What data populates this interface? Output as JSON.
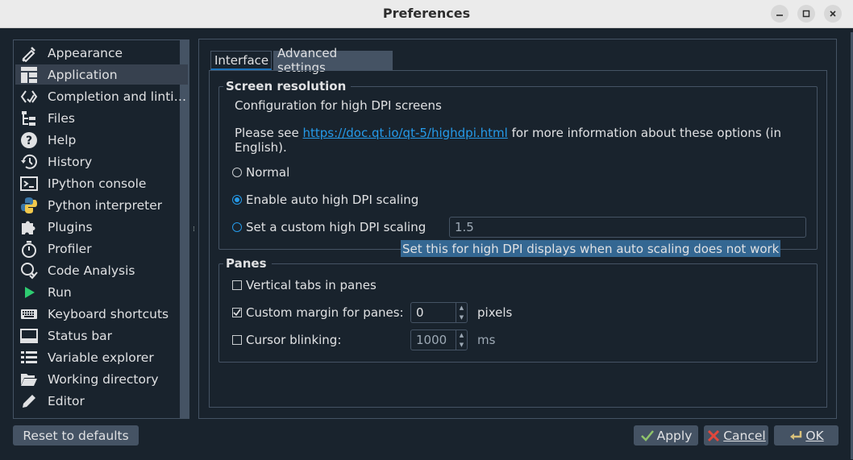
{
  "window": {
    "title": "Preferences"
  },
  "sidebar": {
    "items": [
      {
        "label": "Appearance",
        "icon": "brush-icon"
      },
      {
        "label": "Application",
        "icon": "layout-icon"
      },
      {
        "label": "Completion and linti…",
        "icon": "code-icon"
      },
      {
        "label": "Files",
        "icon": "file-tree-icon"
      },
      {
        "label": "Help",
        "icon": "help-icon"
      },
      {
        "label": "History",
        "icon": "history-icon"
      },
      {
        "label": "IPython console",
        "icon": "terminal-icon"
      },
      {
        "label": "Python interpreter",
        "icon": "python-icon"
      },
      {
        "label": "Plugins",
        "icon": "puzzle-icon"
      },
      {
        "label": "Profiler",
        "icon": "stopwatch-icon"
      },
      {
        "label": "Code Analysis",
        "icon": "code-analysis-icon"
      },
      {
        "label": "Run",
        "icon": "play-icon"
      },
      {
        "label": "Keyboard shortcuts",
        "icon": "keyboard-icon"
      },
      {
        "label": "Status bar",
        "icon": "status-bar-icon"
      },
      {
        "label": "Variable explorer",
        "icon": "list-icon"
      },
      {
        "label": "Working directory",
        "icon": "folder-open-icon"
      },
      {
        "label": "Editor",
        "icon": "pencil-icon"
      }
    ],
    "selected": "Application"
  },
  "tabs": {
    "interface": "Interface",
    "advanced": "Advanced settings"
  },
  "screen_resolution": {
    "title": "Screen resolution",
    "description": "Configuration for high DPI screens",
    "please_see": "Please see ",
    "link": "https://doc.qt.io/qt-5/highdpi.html",
    "more_info": " for more information about these options (in",
    "more_info_line2": "English).",
    "normal_label": "Normal",
    "auto_label": "Enable auto high DPI scaling",
    "custom_label": "Set a custom high DPI scaling",
    "custom_value": "1.5",
    "tooltip": "Set this for high DPI displays when auto scaling does not work"
  },
  "panes": {
    "title": "Panes",
    "vertical_tabs_label": "Vertical tabs in panes",
    "vertical_tabs_checked": false,
    "custom_margin_label": "Custom margin for panes:",
    "custom_margin_checked": true,
    "custom_margin_value": "0",
    "custom_margin_unit": "pixels",
    "cursor_blinking_label": "Cursor blinking:",
    "cursor_blinking_checked": false,
    "cursor_blinking_value": "1000",
    "cursor_blinking_unit": "ms"
  },
  "buttons": {
    "reset": "Reset to defaults",
    "apply": "Apply",
    "cancel": "Cancel",
    "ok": "OK"
  },
  "colors": {
    "background": "#19232d",
    "border": "#455364",
    "accent": "#259ae9",
    "selection": "#346792"
  }
}
